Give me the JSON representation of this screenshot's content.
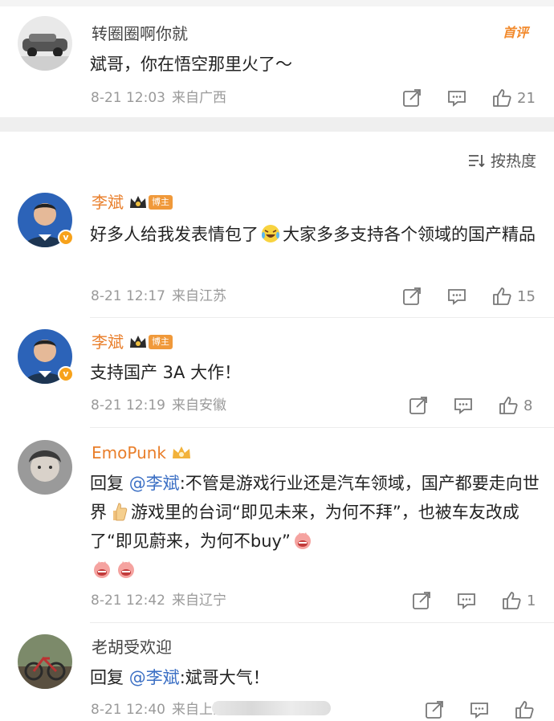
{
  "first_comment": {
    "username": "转圈圈啊你就",
    "text": "斌哥，你在悟空那里火了～",
    "date": "8-21 12:03",
    "source": "来自广西",
    "likes": "21",
    "top_label": "首评"
  },
  "sort": {
    "label": "按热度"
  },
  "comments": [
    {
      "username": "李斌",
      "badge": "博主",
      "text_a": "好多人给我发表情包了",
      "text_b": "大家多多支持各个领域的国产精品",
      "date": "8-21 12:17",
      "source": "来自江苏",
      "likes": "15"
    },
    {
      "username": "李斌",
      "badge": "博主",
      "text": "支持国产 3A 大作！",
      "date": "8-21 12:19",
      "source": "来自安徽",
      "likes": "8"
    },
    {
      "username": "EmoPunk",
      "reply_prefix": "回复 ",
      "mention": "@李斌",
      "text_a": ":不管是游戏行业还是汽车领域，国产都要走向世界",
      "text_b": "游戏里的台词“即见未来，为何不拜”，也被车友改成了“即见蔚来，为何不buy”",
      "date": "8-21 12:42",
      "source": "来自辽宁",
      "likes": "1"
    },
    {
      "username": "老胡受欢迎",
      "reply_prefix": "回复 ",
      "mention": "@李斌",
      "text": ":斌哥大气！",
      "date": "8-21 12:40",
      "source": "来自上海"
    }
  ],
  "colors": {
    "accent_orange": "#e97e2a",
    "mention_blue": "#3b6fc4",
    "meta_gray": "#9a9a9a"
  }
}
